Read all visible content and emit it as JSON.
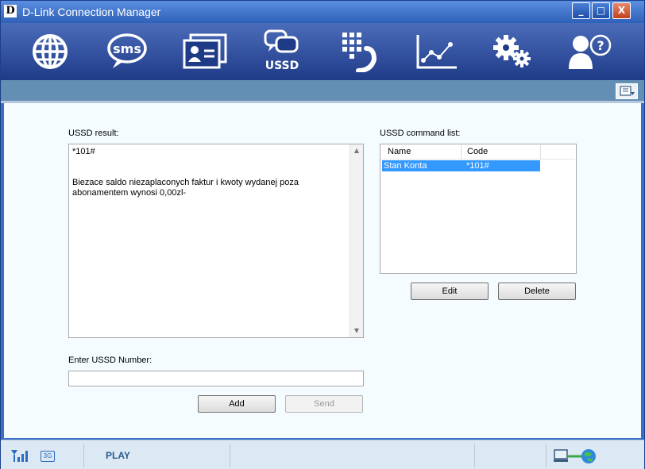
{
  "window": {
    "logo": "D",
    "title": "D-Link Connection Manager",
    "controls": {
      "minimize": "_",
      "maximize": "□",
      "close": "X"
    }
  },
  "toolbar": {
    "items": [
      {
        "name": "internet",
        "icon": "globe-icon"
      },
      {
        "name": "sms",
        "icon": "sms-bubble-icon",
        "label": "sms"
      },
      {
        "name": "contacts",
        "icon": "contact-cards-icon"
      },
      {
        "name": "ussd",
        "icon": "ussd-bubbles-icon",
        "label": "USSD"
      },
      {
        "name": "phone",
        "icon": "dialpad-phone-icon"
      },
      {
        "name": "statistics",
        "icon": "line-chart-icon"
      },
      {
        "name": "settings",
        "icon": "gears-icon"
      },
      {
        "name": "help",
        "icon": "person-question-icon",
        "label": "?"
      }
    ]
  },
  "ussd": {
    "result_label": "USSD result:",
    "result_command": "*101#",
    "result_lines": [
      "Biezace saldo niezaplaconych faktur i kwoty wydanej poza",
      "abonamentem wynosi 0,00zl-"
    ],
    "enter_label": "Enter USSD Number:",
    "enter_value": "",
    "add_label": "Add",
    "send_label": "Send",
    "command_list_label": "USSD command list:",
    "columns": [
      "Name",
      "Code"
    ],
    "commands": [
      {
        "name": "Stan Konta",
        "code": "*101#"
      }
    ],
    "edit_label": "Edit",
    "delete_label": "Delete"
  },
  "status": {
    "network_type": "3G",
    "operator": "PLAY"
  }
}
